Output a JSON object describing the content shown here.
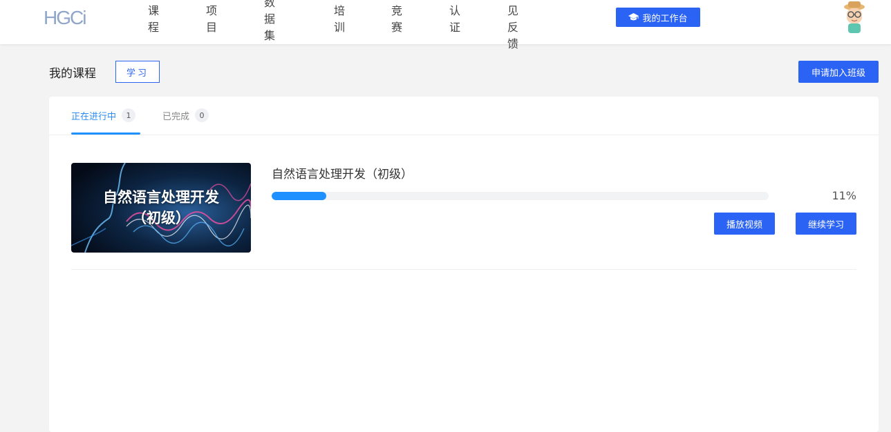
{
  "header": {
    "logo_text": "HGCi",
    "nav": [
      "课程",
      "项目",
      "数据集",
      "培训",
      "竞赛",
      "认证",
      "意见反馈"
    ],
    "workbench_label": "我的工作台",
    "workbench_icon": "graduation-cap-icon"
  },
  "page": {
    "title": "我的课程",
    "study_tab": "学习",
    "join_class_label": "申请加入班级"
  },
  "tabs": [
    {
      "label": "正在进行中",
      "count": "1",
      "active": true
    },
    {
      "label": "已完成",
      "count": "0",
      "active": false
    }
  ],
  "courses": [
    {
      "title": "自然语言处理开发（初级）",
      "thumb_line1": "自然语言处理开发",
      "thumb_line2": "（初级）",
      "progress": 0.11,
      "progress_text": "11%",
      "play_label": "播放视频",
      "continue_label": "继续学习"
    }
  ],
  "colors": {
    "accent": "#2b63f4",
    "progress": "#1e90ff",
    "active_tab": "#2b8cf4"
  }
}
